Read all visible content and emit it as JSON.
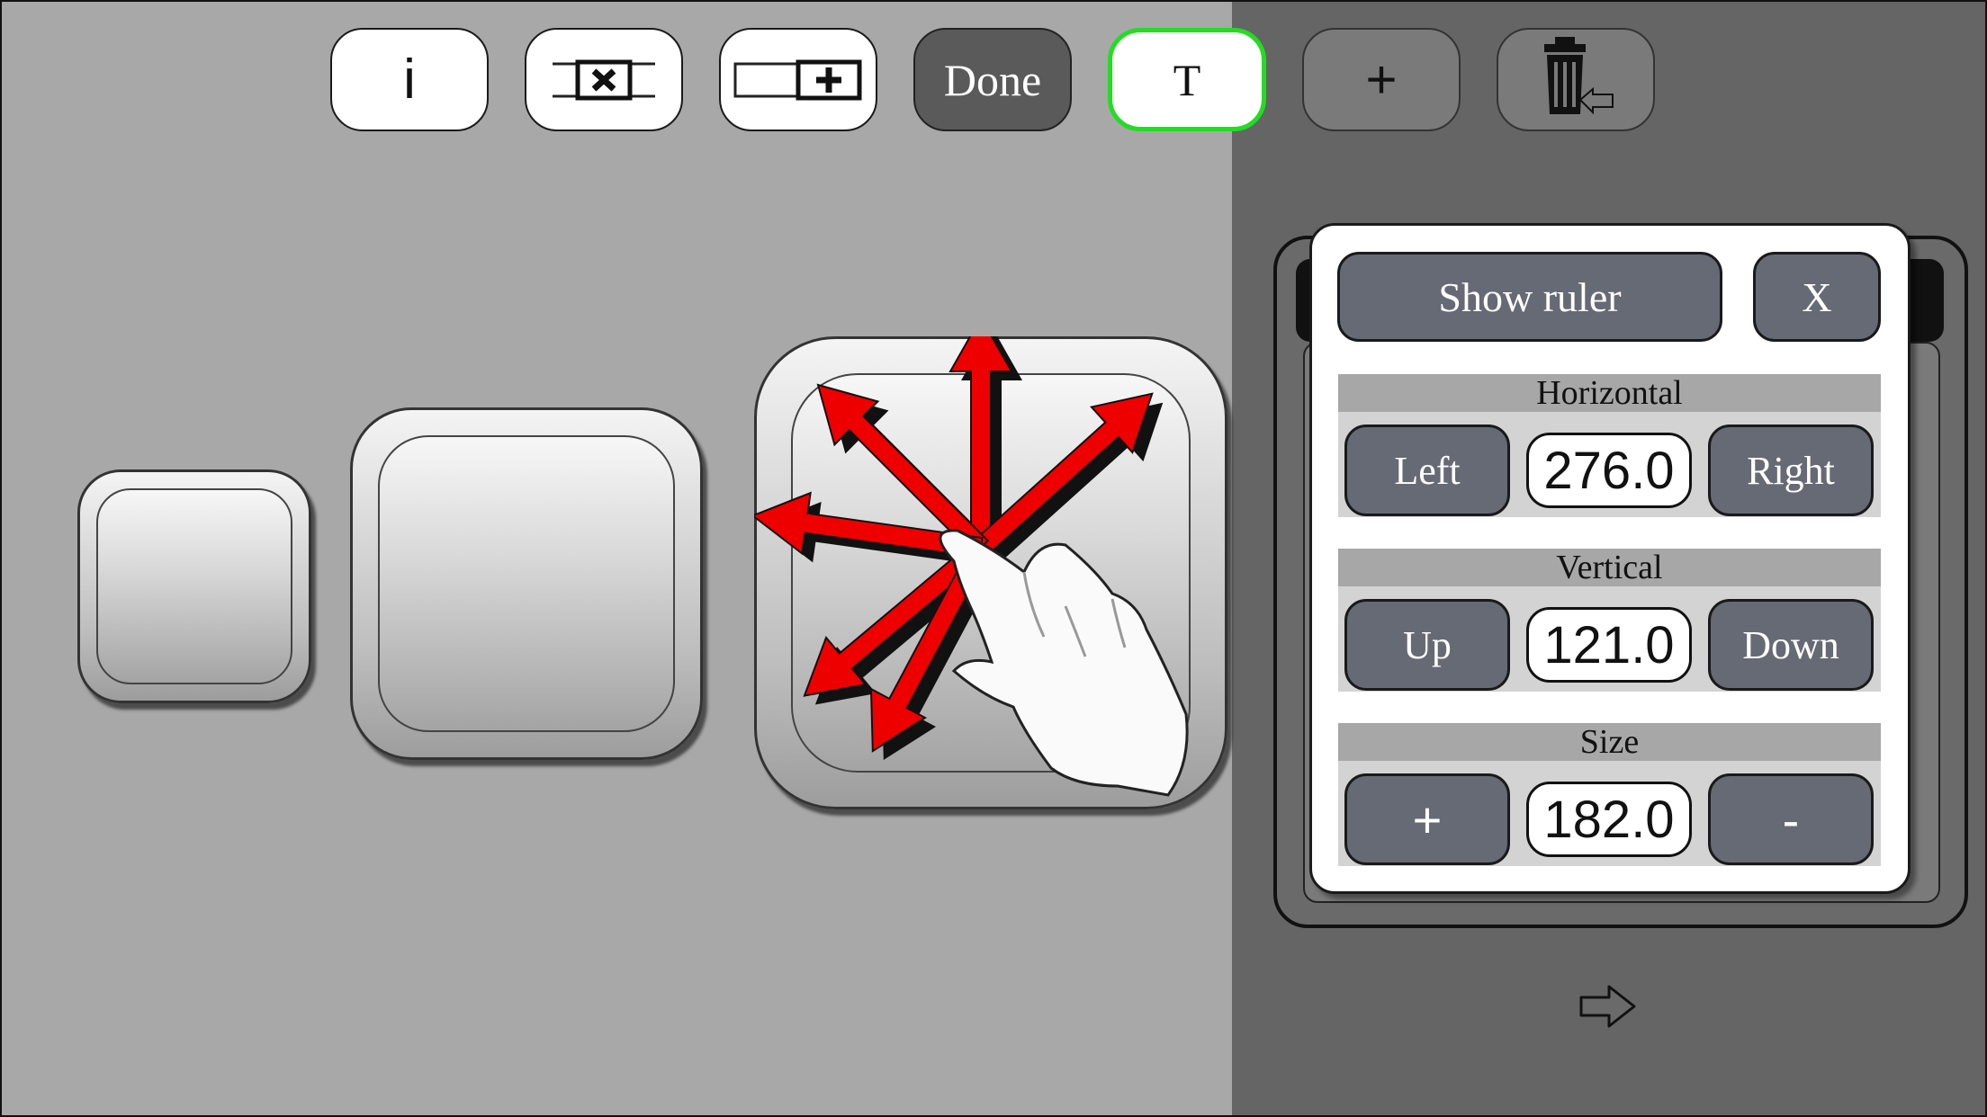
{
  "toolbar": {
    "info_label": "i",
    "done_label": "Done",
    "text_label": "T",
    "add_label": "+"
  },
  "panel": {
    "show_ruler_label": "Show ruler",
    "close_label": "X",
    "horizontal": {
      "title": "Horizontal",
      "left_label": "Left",
      "value": "276.0",
      "right_label": "Right"
    },
    "vertical": {
      "title": "Vertical",
      "up_label": "Up",
      "value": "121.0",
      "down_label": "Down"
    },
    "size": {
      "title": "Size",
      "plus_label": "+",
      "value": "182.0",
      "minus_label": "-"
    }
  },
  "icons": [
    "info-icon",
    "remove-cell-icon",
    "add-cell-icon",
    "trash-icon",
    "move-arrows-icon",
    "hand-pointer-icon",
    "next-arrow-icon"
  ],
  "colors": {
    "selected_border": "#22dd22",
    "arrows": "#ee0000",
    "panel_button": "#666a74"
  }
}
